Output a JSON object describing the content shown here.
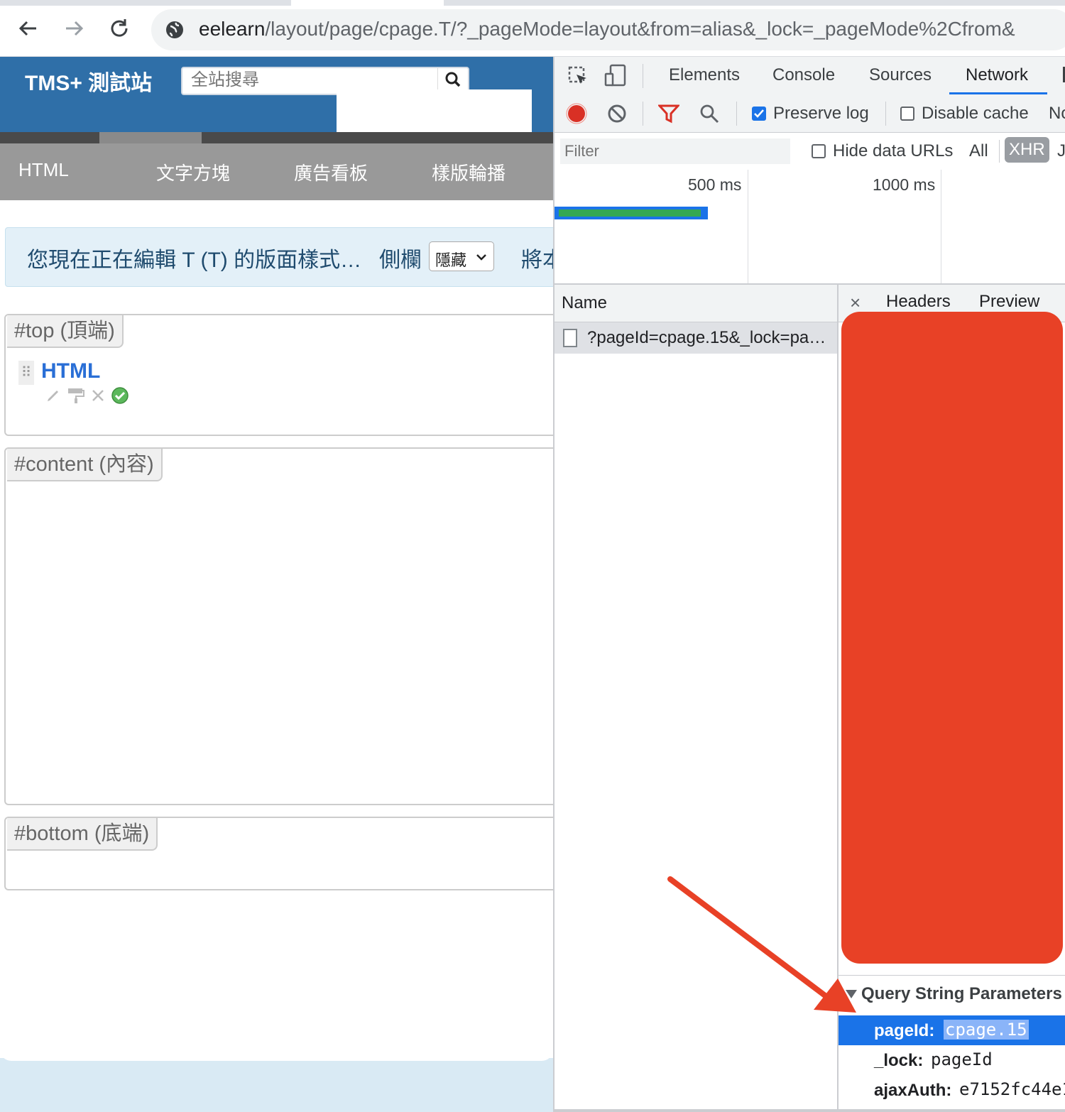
{
  "browser": {
    "url_host": "eelearn",
    "url_path": "/layout/page/cpage.T/?_pageMode=layout&from=alias&_lock=_pageMode%2Cfrom&",
    "back_icon": "arrow-left-icon",
    "forward_icon": "arrow-right-icon",
    "reload_icon": "reload-icon",
    "site_info_icon": "globe-icon"
  },
  "site": {
    "title": "TMS+ 測試站",
    "search_placeholder": "全站搜尋",
    "menu": [
      "HTML",
      "文字方塊",
      "廣告看板",
      "樣版輪播"
    ]
  },
  "notice": {
    "text": "您現在正在編輯 T (T) 的版面樣式…",
    "sidebar_label": "側欄",
    "sidebar_value": "隱藏",
    "trailing_text": "將本"
  },
  "regions": {
    "top": "#top (頂端)",
    "content": "#content (內容)",
    "bottom": "#bottom (底端)"
  },
  "widget": {
    "title": "HTML"
  },
  "devtools": {
    "tabs": [
      "Elements",
      "Console",
      "Sources",
      "Network"
    ],
    "active_tab": "Network",
    "preserve_log": "Preserve log",
    "preserve_log_checked": true,
    "disable_cache": "Disable cache",
    "throttle_partial": "No",
    "filter_placeholder": "Filter",
    "hide_data_urls": "Hide data URLs",
    "type_all": "All",
    "type_xhr": "XHR",
    "type_js_partial": "J",
    "timeline_ticks": [
      "500 ms",
      "1000 ms"
    ],
    "name_header": "Name",
    "request_name": "?pageId=cpage.15&_lock=pa…",
    "detail_close": "×",
    "detail_tabs": [
      "Headers",
      "Preview"
    ],
    "query_string_header": "Query String Parameters",
    "params": [
      {
        "key": "pageId:",
        "value": "cpage.15"
      },
      {
        "key": "_lock:",
        "value": "pageId"
      },
      {
        "key": "ajaxAuth:",
        "value": "e7152fc44e1"
      }
    ]
  },
  "colors": {
    "site_header": "#2f6fa8",
    "menu_bar": "#999999",
    "accent_blue": "#1a73e8",
    "redaction": "#e84126",
    "arrow": "#e84126"
  }
}
